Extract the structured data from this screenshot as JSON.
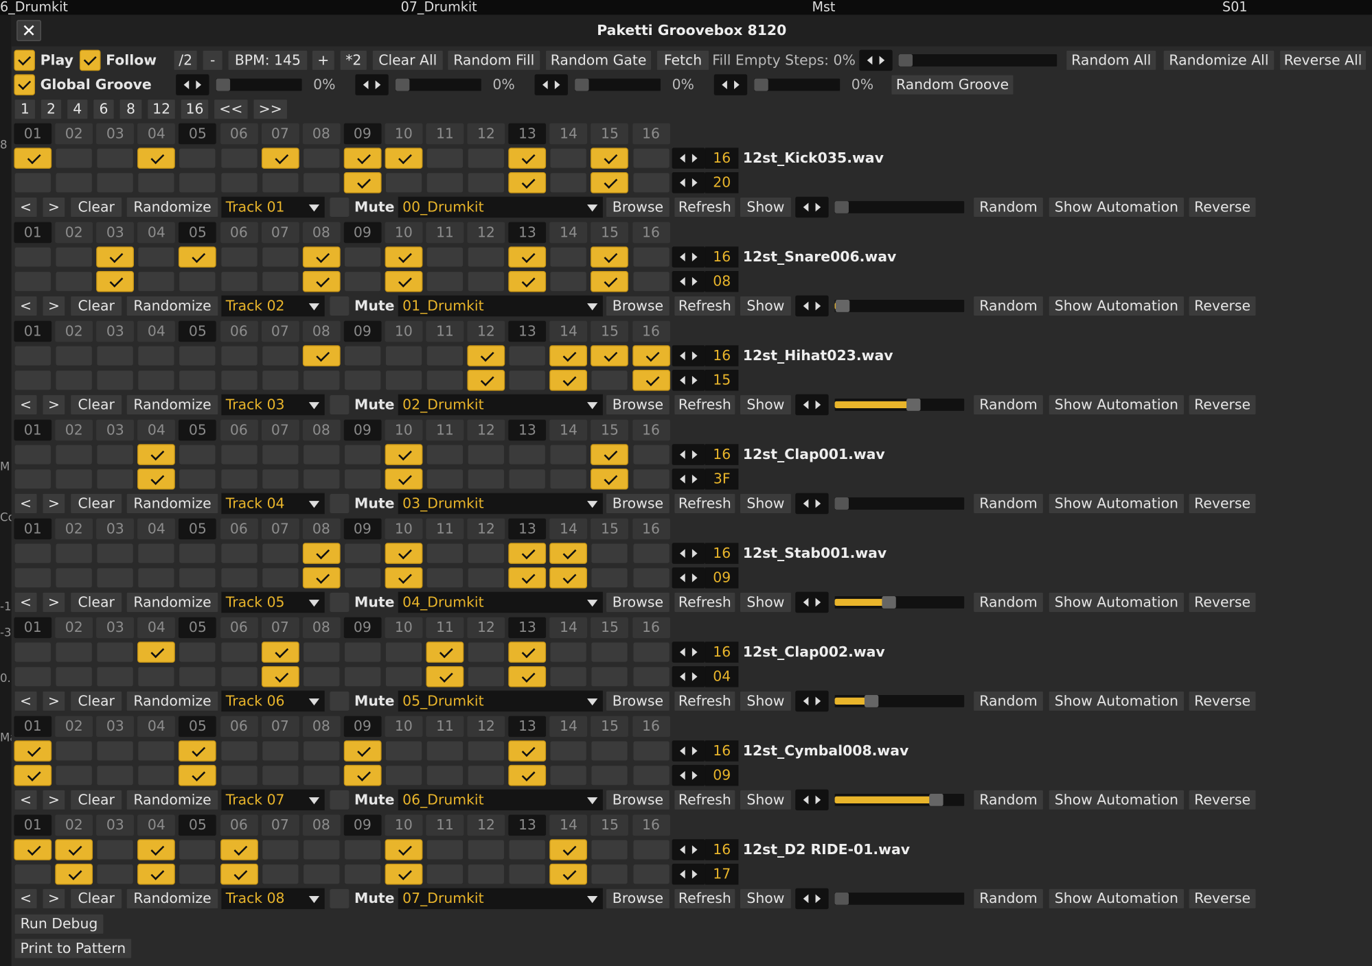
{
  "top_strip": {
    "col1": "6_Drumkit",
    "col2": "07_Drumkit",
    "col3": "Mst",
    "col4": "S01"
  },
  "left_strip_fragments": [
    "8",
    "M",
    "Co",
    "-1",
    "-3",
    "0.",
    "Ma"
  ],
  "window": {
    "title": "Paketti Groovebox 8120",
    "close_label": "✕"
  },
  "toolbar": {
    "play_label": "Play",
    "play_checked": true,
    "follow_label": "Follow",
    "follow_checked": true,
    "half_label": "/2",
    "minus_label": "-",
    "bpm_label": "BPM: 145",
    "plus_label": "+",
    "double_label": "*2",
    "clear_all_label": "Clear All",
    "random_fill_label": "Random Fill",
    "random_gate_label": "Random Gate",
    "fetch_label": "Fetch",
    "fill_empty_label": "Fill Empty Steps: 0%",
    "fill_empty_value": 0,
    "random_all_label": "Random All",
    "randomize_all_label": "Randomize All",
    "reverse_all_label": "Reverse All"
  },
  "global_groove": {
    "label": "Global Groove",
    "checked": true,
    "sliders": [
      {
        "pct_label": "0%",
        "value": 0
      },
      {
        "pct_label": "0%",
        "value": 0
      },
      {
        "pct_label": "0%",
        "value": 0
      },
      {
        "pct_label": "0%",
        "value": 0
      }
    ],
    "random_groove_label": "Random Groove"
  },
  "step_count_buttons": [
    "1",
    "2",
    "4",
    "6",
    "8",
    "12",
    "16",
    "<<",
    ">>"
  ],
  "step_numbers": [
    "01",
    "02",
    "03",
    "04",
    "05",
    "06",
    "07",
    "08",
    "09",
    "10",
    "11",
    "12",
    "13",
    "14",
    "15",
    "16"
  ],
  "dark_step_indices": [
    0,
    4,
    8,
    12
  ],
  "track_controls": {
    "prev_label": "<",
    "next_label": ">",
    "clear_label": "Clear",
    "randomize_label": "Randomize",
    "mute_label": "Mute",
    "browse_label": "Browse",
    "refresh_label": "Refresh",
    "show_label": "Show",
    "random_label": "Random",
    "show_automation_label": "Show Automation",
    "reverse_label": "Reverse"
  },
  "tracks": [
    {
      "name": "Track 01",
      "sample": "12st_Kick035.wav",
      "steps_label": "16",
      "value2": "20",
      "instrument": "00_Drumkit",
      "slider_value": 0,
      "row1": [
        1,
        0,
        0,
        1,
        0,
        0,
        1,
        0,
        1,
        1,
        0,
        0,
        1,
        0,
        1,
        0
      ],
      "row2": [
        0,
        0,
        0,
        0,
        0,
        0,
        0,
        0,
        1,
        0,
        0,
        0,
        1,
        0,
        1,
        0
      ]
    },
    {
      "name": "Track 02",
      "sample": "12st_Snare006.wav",
      "steps_label": "16",
      "value2": "08",
      "instrument": "01_Drumkit",
      "slider_value": 0.01,
      "row1": [
        0,
        0,
        1,
        0,
        1,
        0,
        0,
        1,
        0,
        1,
        0,
        0,
        1,
        0,
        1,
        0
      ],
      "row2": [
        0,
        0,
        1,
        0,
        0,
        0,
        0,
        1,
        0,
        1,
        0,
        0,
        1,
        0,
        1,
        0
      ]
    },
    {
      "name": "Track 03",
      "sample": "12st_Hihat023.wav",
      "steps_label": "16",
      "value2": "15",
      "instrument": "02_Drumkit",
      "slider_value": 0.62,
      "row1": [
        0,
        0,
        0,
        0,
        0,
        0,
        0,
        1,
        0,
        0,
        0,
        1,
        0,
        1,
        1,
        1
      ],
      "row2": [
        0,
        0,
        0,
        0,
        0,
        0,
        0,
        0,
        0,
        0,
        0,
        1,
        0,
        1,
        0,
        1
      ]
    },
    {
      "name": "Track 04",
      "sample": "12st_Clap001.wav",
      "steps_label": "16",
      "value2": "3F",
      "instrument": "03_Drumkit",
      "slider_value": 0,
      "row1": [
        0,
        0,
        0,
        1,
        0,
        0,
        0,
        0,
        0,
        1,
        0,
        0,
        0,
        0,
        1,
        0
      ],
      "row2": [
        0,
        0,
        0,
        1,
        0,
        0,
        0,
        0,
        0,
        1,
        0,
        0,
        0,
        0,
        1,
        0
      ]
    },
    {
      "name": "Track 05",
      "sample": "12st_Stab001.wav",
      "steps_label": "16",
      "value2": "09",
      "instrument": "04_Drumkit",
      "slider_value": 0.41,
      "row1": [
        0,
        0,
        0,
        0,
        0,
        0,
        0,
        1,
        0,
        1,
        0,
        0,
        1,
        1,
        0,
        0
      ],
      "row2": [
        0,
        0,
        0,
        0,
        0,
        0,
        0,
        1,
        0,
        1,
        0,
        0,
        1,
        1,
        0,
        0
      ]
    },
    {
      "name": "Track 06",
      "sample": "12st_Clap002.wav",
      "steps_label": "16",
      "value2": "04",
      "instrument": "05_Drumkit",
      "slider_value": 0.26,
      "row1": [
        0,
        0,
        0,
        1,
        0,
        0,
        1,
        0,
        0,
        0,
        1,
        0,
        1,
        0,
        0,
        0
      ],
      "row2": [
        0,
        0,
        0,
        0,
        0,
        0,
        1,
        0,
        0,
        0,
        1,
        0,
        1,
        0,
        0,
        0
      ]
    },
    {
      "name": "Track 07",
      "sample": "12st_Cymbal008.wav",
      "steps_label": "16",
      "value2": "09",
      "instrument": "06_Drumkit",
      "slider_value": 0.82,
      "row1": [
        1,
        0,
        0,
        0,
        1,
        0,
        0,
        0,
        1,
        0,
        0,
        0,
        1,
        0,
        0,
        0
      ],
      "row2": [
        1,
        0,
        0,
        0,
        1,
        0,
        0,
        0,
        1,
        0,
        0,
        0,
        1,
        0,
        0,
        0
      ]
    },
    {
      "name": "Track 08",
      "sample": "12st_D2 RIDE-01.wav",
      "steps_label": "16",
      "value2": "17",
      "instrument": "07_Drumkit",
      "slider_value": 0,
      "row1": [
        1,
        1,
        0,
        1,
        0,
        1,
        0,
        0,
        0,
        1,
        0,
        0,
        0,
        1,
        0,
        0
      ],
      "row2": [
        0,
        1,
        0,
        1,
        0,
        1,
        0,
        0,
        0,
        1,
        0,
        0,
        0,
        1,
        0,
        0
      ]
    }
  ],
  "footer": {
    "run_debug_label": "Run Debug",
    "print_label": "Print to Pattern"
  },
  "colors": {
    "accent": "#e9b52b",
    "background": "#2a2a2a",
    "button": "#3b3b3b"
  }
}
